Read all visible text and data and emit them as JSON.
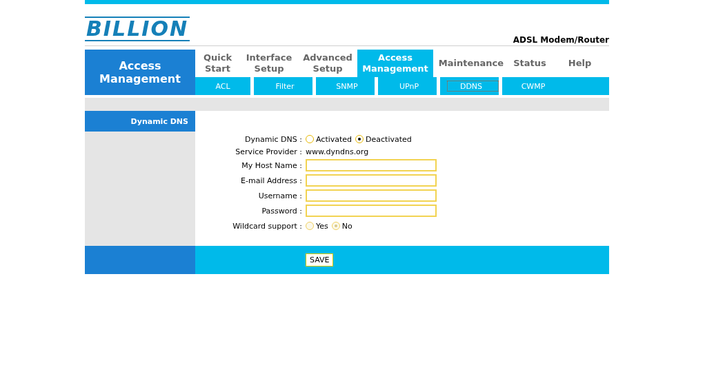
{
  "header": {
    "logo": "BILLION",
    "product": "ADSL Modem/Router"
  },
  "section_title": "Access Management",
  "tabs": [
    {
      "label": "Quick Start",
      "selected": false
    },
    {
      "label": "Interface Setup",
      "selected": false
    },
    {
      "label": "Advanced Setup",
      "selected": false
    },
    {
      "label": "Access Management",
      "selected": true
    },
    {
      "label": "Maintenance",
      "selected": false
    },
    {
      "label": "Status",
      "selected": false
    },
    {
      "label": "Help",
      "selected": false
    }
  ],
  "subtabs": [
    {
      "label": "ACL",
      "selected": false
    },
    {
      "label": "Filter",
      "selected": false
    },
    {
      "label": "SNMP",
      "selected": false
    },
    {
      "label": "UPnP",
      "selected": false
    },
    {
      "label": "DDNS",
      "selected": true
    },
    {
      "label": "CWMP",
      "selected": false
    }
  ],
  "sidebar_title": "Dynamic DNS",
  "form": [
    {
      "kind": "radio",
      "label": "Dynamic DNS :",
      "options": [
        {
          "label": "Activated",
          "selected": false
        },
        {
          "label": "Deactivated",
          "selected": true
        }
      ],
      "disabled": false
    },
    {
      "kind": "text",
      "label": "Service Provider :",
      "value": "www.dyndns.org"
    },
    {
      "kind": "input",
      "label": "My Host Name :"
    },
    {
      "kind": "input",
      "label": "E-mail Address :"
    },
    {
      "kind": "input",
      "label": "Username :"
    },
    {
      "kind": "input",
      "label": "Password :"
    },
    {
      "kind": "radio",
      "label": "Wildcard support :",
      "options": [
        {
          "label": "Yes",
          "selected": false
        },
        {
          "label": "No",
          "selected": true
        }
      ],
      "disabled": true
    }
  ],
  "save_button": "SAVE"
}
